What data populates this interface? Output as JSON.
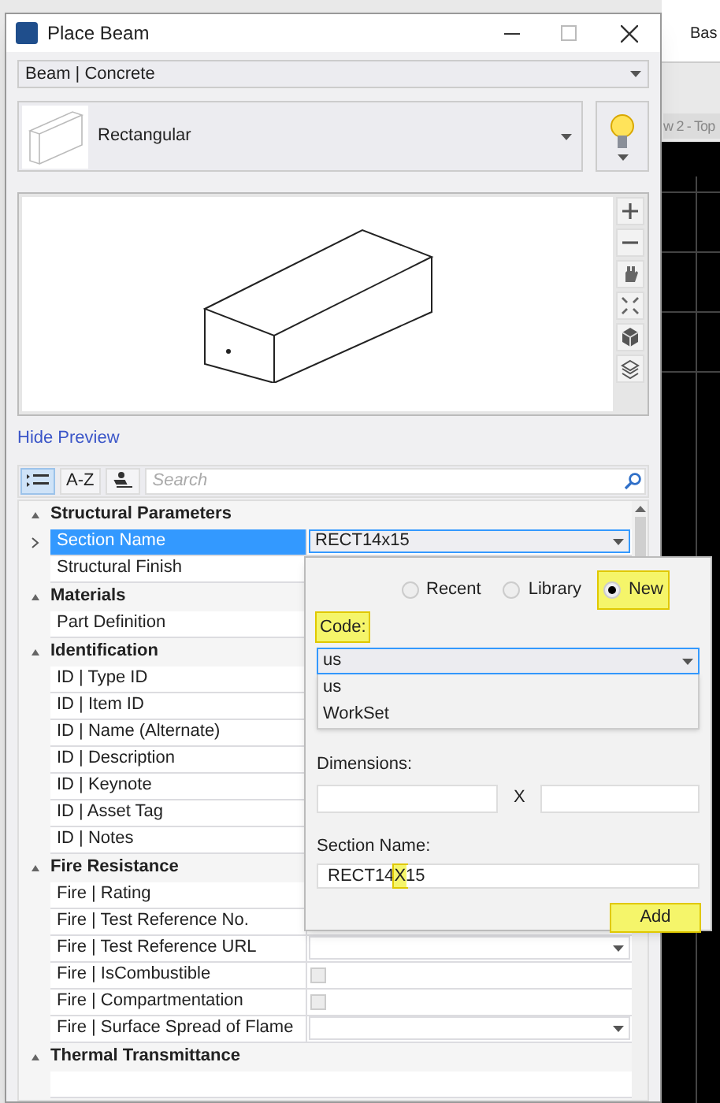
{
  "background_app": {
    "texts": [
      "Bas",
      "w 2 - Top"
    ]
  },
  "window": {
    "title": "Place Beam"
  },
  "family_dropdown": {
    "value": "Beam | Concrete"
  },
  "shape_picker": {
    "value": "Rectangular"
  },
  "hide_preview_link": "Hide Preview",
  "view_modes": [
    {
      "kind": "categorized",
      "selected": true
    },
    {
      "kind": "text",
      "label": "A-Z",
      "selected": false
    },
    {
      "kind": "sort",
      "selected": false
    }
  ],
  "search": {
    "placeholder": "Search"
  },
  "property_groups": [
    {
      "title": "Structural Parameters",
      "expanded": true,
      "rows": [
        {
          "label": "Section Name",
          "selected": true,
          "kind": "dropdown",
          "value": "RECT14x15"
        },
        {
          "label": "Structural Finish",
          "selected": false,
          "kind": "text"
        }
      ]
    },
    {
      "title": "Materials",
      "expanded": true,
      "rows": [
        {
          "label": "Part Definition",
          "selected": false,
          "kind": "text"
        }
      ]
    },
    {
      "title": "Identification",
      "expanded": true,
      "rows": [
        {
          "label": "ID | Type ID",
          "selected": false,
          "kind": "text"
        },
        {
          "label": "ID | Item ID",
          "selected": false,
          "kind": "text"
        },
        {
          "label": "ID | Name (Alternate)",
          "selected": false,
          "kind": "text"
        },
        {
          "label": "ID | Description",
          "selected": false,
          "kind": "text"
        },
        {
          "label": "ID | Keynote",
          "selected": false,
          "kind": "text"
        },
        {
          "label": "ID | Asset Tag",
          "selected": false,
          "kind": "text"
        },
        {
          "label": "ID | Notes",
          "selected": false,
          "kind": "text"
        }
      ]
    },
    {
      "title": "Fire Resistance",
      "expanded": true,
      "rows": [
        {
          "label": "Fire | Rating",
          "selected": false,
          "kind": "text"
        },
        {
          "label": "Fire | Test Reference No.",
          "selected": false,
          "kind": "text"
        },
        {
          "label": "Fire | Test Reference URL",
          "selected": false,
          "kind": "dropdown"
        },
        {
          "label": "Fire | IsCombustible",
          "selected": false,
          "kind": "checkbox",
          "checked": false
        },
        {
          "label": "Fire | Compartmentation",
          "selected": false,
          "kind": "checkbox",
          "checked": false
        },
        {
          "label": "Fire | Surface Spread of Flame",
          "selected": false,
          "kind": "dropdown"
        }
      ]
    },
    {
      "title": "Thermal Transmittance",
      "expanded": true
    }
  ],
  "section_popup": {
    "source_options": [
      {
        "label": "Recent",
        "selected": false,
        "highlighted": false
      },
      {
        "label": "Library",
        "selected": false,
        "highlighted": false
      },
      {
        "label": "New",
        "selected": true,
        "highlighted": true
      }
    ],
    "code_label": {
      "text": "Code:",
      "highlighted": true
    },
    "code_dropdown": {
      "value": "us",
      "options": [
        "us",
        "WorkSet"
      ]
    },
    "dimensions_label": "Dimensions:",
    "dimensions_separator": "X",
    "section_name_label": "Section Name:",
    "section_name_value": [
      {
        "text": "RECT14",
        "highlighted": false
      },
      {
        "text": "X",
        "highlighted": true
      },
      {
        "text": "15",
        "highlighted": false
      }
    ],
    "add_button": {
      "label": "Add",
      "highlighted": true
    }
  }
}
